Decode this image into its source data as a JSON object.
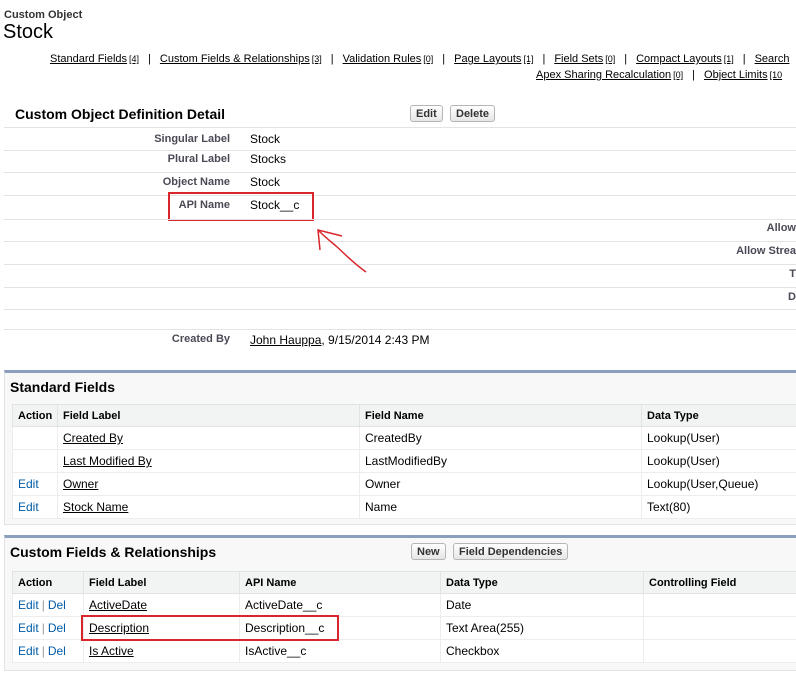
{
  "header": {
    "object_type": "Custom Object",
    "object_name": "Stock"
  },
  "related_links": {
    "row1": [
      {
        "label": "Standard Fields",
        "count": "[4]"
      },
      {
        "label": "Custom Fields & Relationships",
        "count": "[3]"
      },
      {
        "label": "Validation Rules",
        "count": "[0]"
      },
      {
        "label": "Page Layouts",
        "count": "[1]"
      },
      {
        "label": "Field Sets",
        "count": "[0]"
      },
      {
        "label": "Compact Layouts",
        "count": "[1]"
      },
      {
        "label": "Search",
        "count": ""
      }
    ],
    "row2": [
      {
        "label": "Apex Sharing Recalculation",
        "count": "[0]"
      },
      {
        "label": "Object Limits",
        "count": "[10"
      }
    ],
    "separator": "|"
  },
  "detail": {
    "title": "Custom Object Definition Detail",
    "edit_label": "Edit",
    "delete_label": "Delete",
    "fields": [
      {
        "label": "Singular Label",
        "value": "Stock"
      },
      {
        "label": "Plural Label",
        "value": "Stocks"
      },
      {
        "label": "Object Name",
        "value": "Stock"
      },
      {
        "label": "API Name",
        "value": "Stock__c"
      }
    ],
    "right_labels": [
      "Allow",
      "Allow Strea",
      "T",
      "D"
    ],
    "created_by_label": "Created By",
    "created_by_user": "John Hauppa",
    "created_by_date": ", 9/15/2014 2:43 PM"
  },
  "standard_fields": {
    "title": "Standard Fields",
    "columns": [
      "Action",
      "Field Label",
      "Field Name",
      "Data Type"
    ],
    "rows": [
      {
        "action": "",
        "label": "Created By",
        "name": "CreatedBy",
        "type": "Lookup(User)"
      },
      {
        "action": "",
        "label": "Last Modified By",
        "name": "LastModifiedBy",
        "type": "Lookup(User)"
      },
      {
        "action": "Edit",
        "label": "Owner",
        "name": "Owner",
        "type": "Lookup(User,Queue)"
      },
      {
        "action": "Edit",
        "label": "Stock Name",
        "name": "Name",
        "type": "Text(80)"
      }
    ]
  },
  "custom_fields": {
    "title": "Custom Fields & Relationships",
    "new_label": "New",
    "deps_label": "Field Dependencies",
    "columns": [
      "Action",
      "Field Label",
      "API Name",
      "Data Type",
      "Controlling Field"
    ],
    "edit_label": "Edit",
    "del_label": "Del",
    "pipe": "|",
    "rows": [
      {
        "label": "ActiveDate",
        "api": "ActiveDate__c",
        "type": "Date",
        "ctrl": ""
      },
      {
        "label": "Description",
        "api": "Description__c",
        "type": "Text Area(255)",
        "ctrl": ""
      },
      {
        "label": "Is Active",
        "api": "IsActive__c",
        "type": "Checkbox",
        "ctrl": ""
      }
    ]
  },
  "colors": {
    "annotation_red": "#d9262c",
    "link_blue": "#015ba7",
    "panel_border": "#8a9ebe"
  }
}
